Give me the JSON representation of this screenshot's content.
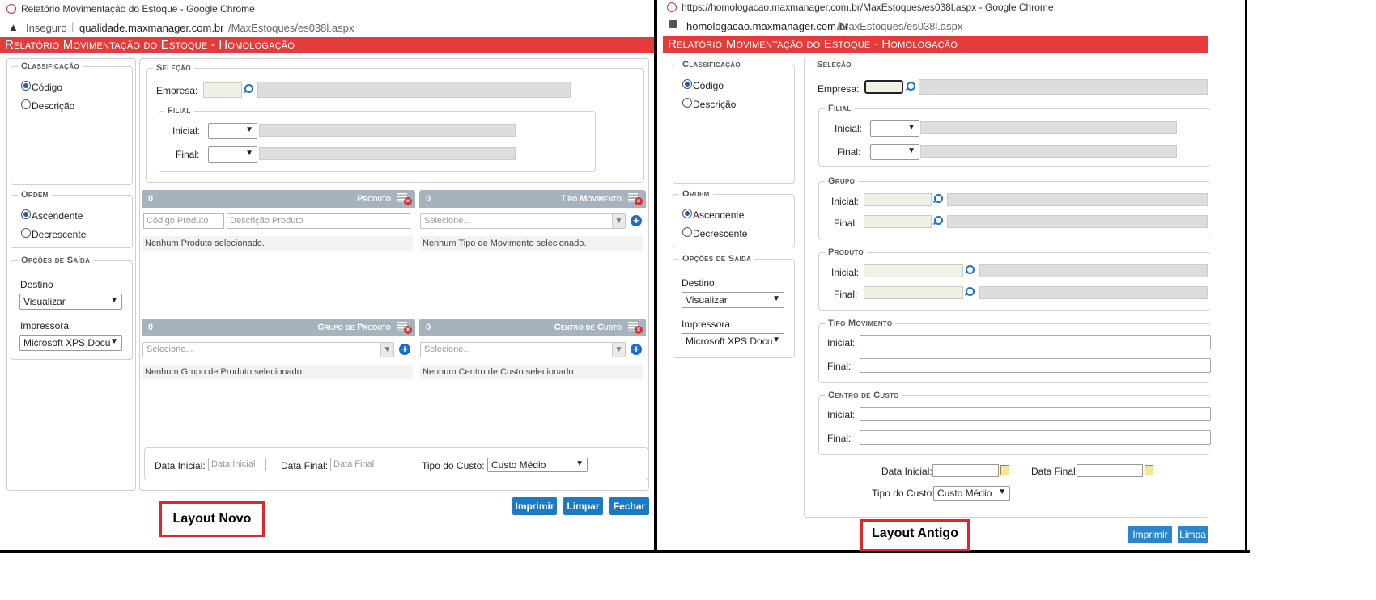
{
  "left": {
    "window_title": "Relatório Movimentação do Estoque - Google Chrome",
    "security_label": "Inseguro",
    "url_domain": "qualidade.maxmanager.com.br",
    "url_path": "/MaxEstoques/es038l.aspx",
    "page_title": "Relatório Movimentação do Estoque  - Homologação",
    "classificacao": {
      "legend": "Classificação",
      "opt1": "Código",
      "opt2": "Descrição"
    },
    "ordem": {
      "legend": "Ordem",
      "opt1": "Ascendente",
      "opt2": "Decrescente"
    },
    "saida": {
      "legend": "Opções de Saída",
      "destino_label": "Destino",
      "destino_value": "Visualizar",
      "impressora_label": "Impressora",
      "impressora_value": "Microsoft XPS Docum"
    },
    "selecao": {
      "legend": "Seleção",
      "empresa_label": "Empresa:",
      "filial_legend": "Filial",
      "inicial_label": "Inicial:",
      "final_label": "Final:"
    },
    "panels": {
      "produto": {
        "count": "0",
        "title": "Produto",
        "ph_code": "Código Produto",
        "ph_desc": "Descrição Produto",
        "empty": "Nenhum Produto selecionado."
      },
      "tipo": {
        "count": "0",
        "title": "Tipo Movimento",
        "select": "Selecione...",
        "empty": "Nenhum Tipo de Movimento selecionado."
      },
      "grupo": {
        "count": "0",
        "title": "Grupo de Produto",
        "select": "Selecione...",
        "empty": "Nenhum Grupo de Produto selecionado."
      },
      "centro": {
        "count": "0",
        "title": "Centro de Custo",
        "select": "Selecione...",
        "empty": "Nenhum Centro de Custo selecionado."
      }
    },
    "datas": {
      "inicial_label": "Data Inicial:",
      "inicial_ph": "Data Inicial",
      "final_label": "Data Final:",
      "final_ph": "Data Final",
      "custo_label": "Tipo do Custo:",
      "custo_value": "Custo Médio"
    },
    "buttons": {
      "imprimir": "Imprimir",
      "limpar": "Limpar",
      "fechar": "Fechar"
    },
    "caption": "Layout Novo"
  },
  "right": {
    "window_title": "https://homologacao.maxmanager.com.br/MaxEstoques/es038l.aspx - Google Chrome",
    "url_domain": "homologacao.maxmanager.com.br",
    "url_path": "/MaxEstoques/es038l.aspx",
    "page_title": "Relatório Movimentação do Estoque  - Homologação",
    "classificacao": {
      "legend": "Classificação",
      "opt1": "Código",
      "opt2": "Descrição"
    },
    "ordem": {
      "legend": "Ordem",
      "opt1": "Ascendente",
      "opt2": "Decrescente"
    },
    "saida": {
      "legend": "Opções de Saída",
      "destino_label": "Destino",
      "destino_value": "Visualizar",
      "impressora_label": "Impressora",
      "impressora_value": "Microsoft XPS Docum"
    },
    "selecao": {
      "legend": "Seleção",
      "empresa_label": "Empresa:"
    },
    "filial": {
      "legend": "Filial",
      "inicial": "Inicial:",
      "final": "Final:"
    },
    "grupo": {
      "legend": "Grupo",
      "inicial": "Inicial:",
      "final": "Final:"
    },
    "produto": {
      "legend": "Produto",
      "inicial": "Inicial:",
      "final": "Final:"
    },
    "tipo": {
      "legend": "Tipo Movimento",
      "inicial": "Inicial:",
      "final": "Final:"
    },
    "centro": {
      "legend": "Centro de Custo",
      "inicial": "Inicial:",
      "final": "Final:"
    },
    "datas": {
      "inicial_label": "Data Inicial:",
      "final_label": "Data Final:",
      "custo_label": "Tipo do Custo:",
      "custo_value": "Custo Médio"
    },
    "buttons": {
      "imprimir": "Imprimir",
      "limpar": "Limpa"
    },
    "caption": "Layout Antigo"
  }
}
